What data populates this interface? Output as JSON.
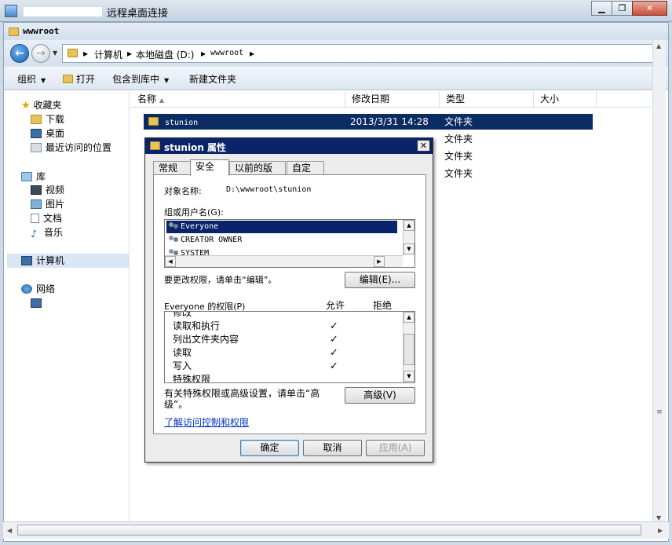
{
  "rdp": {
    "title": "远程桌面连接"
  },
  "explorer": {
    "title": "wwwroot",
    "breadcrumbs": [
      "计算机",
      "本地磁盘 (D:)",
      "wwwroot"
    ],
    "toolbar": {
      "organize": "组织",
      "open": "打开",
      "include_library": "包含到库中",
      "new_folder": "新建文件夹"
    },
    "nav": {
      "favorites": "收藏夹",
      "downloads": "下载",
      "desktop": "桌面",
      "recent": "最近访问的位置",
      "libraries": "库",
      "videos": "视频",
      "pictures": "图片",
      "documents": "文档",
      "music": "音乐",
      "computer": "计算机",
      "network": "网络"
    },
    "columns": {
      "name": "名称",
      "date": "修改日期",
      "type": "类型",
      "size": "大小"
    },
    "files": [
      {
        "name": "stunion",
        "date": "2013/3/31 14:28",
        "type": "文件夹"
      },
      {
        "name": "",
        "date": "",
        "type": "文件夹"
      },
      {
        "name": "",
        "date": "",
        "type": "文件夹"
      },
      {
        "name": "",
        "date": "",
        "type": "文件夹"
      }
    ]
  },
  "dialog": {
    "title": "stunion 属性",
    "tabs": [
      "常规",
      "安全",
      "以前的版本",
      "自定义"
    ],
    "object_label": "对象名称:",
    "object_value": "D:\\wwwroot\\stunion",
    "groups_label": "组或用户名(G):",
    "groups": [
      "Everyone",
      "CREATOR OWNER",
      "SYSTEM"
    ],
    "change_hint": "要更改权限，请单击“编辑”。",
    "edit_button": "编辑(E)...",
    "perm_label": "Everyone 的权限(P)",
    "allow": "允许",
    "deny": "拒绝",
    "permissions": [
      {
        "name": "修改",
        "allow": ""
      },
      {
        "name": "读取和执行",
        "allow": "✓"
      },
      {
        "name": "列出文件夹内容",
        "allow": "✓"
      },
      {
        "name": "读取",
        "allow": "✓"
      },
      {
        "name": "写入",
        "allow": "✓"
      },
      {
        "name": "特殊权限",
        "allow": ""
      }
    ],
    "advanced_hint_1": "有关特殊权限或高级设置，请单击“高",
    "advanced_hint_2": "级”。",
    "advanced_button": "高级(V)",
    "learn_link": "了解访问控制和权限",
    "ok": "确定",
    "cancel": "取消",
    "apply": "应用(A)"
  }
}
